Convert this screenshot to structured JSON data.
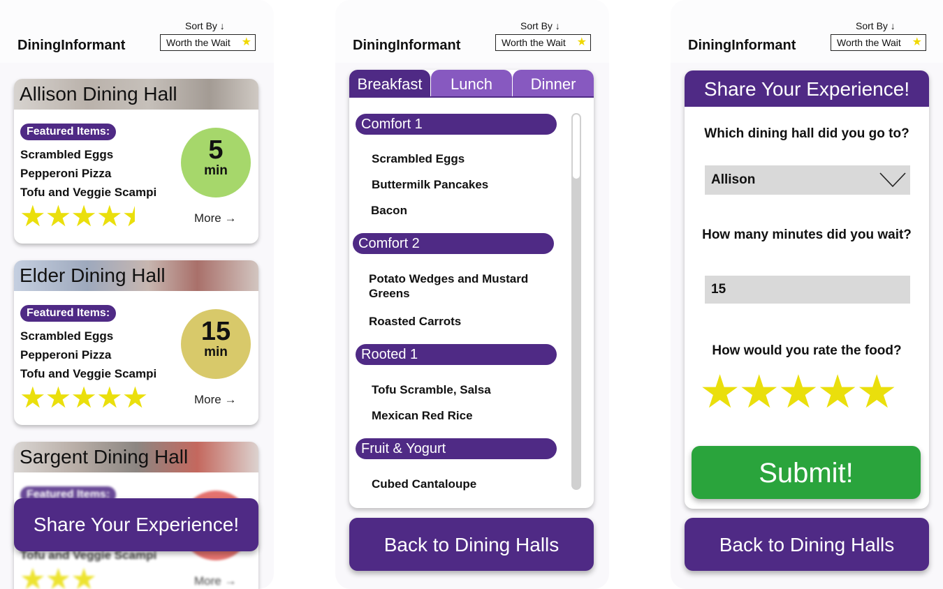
{
  "app": {
    "brand": "DiningInformant",
    "sort_label": "Sort By ↓",
    "sort_value": "Worth the Wait",
    "sort_star": "★",
    "accent_color": "#4f2a85",
    "tab_inactive_color": "#8759c0",
    "star_color": "#eadf0c",
    "submit_color": "#2aa43c"
  },
  "halls": {
    "featured_label": "Featured Items:",
    "more_label": "More →",
    "share_button": "Share Your Experience!",
    "items": [
      {
        "name": "Allison Dining Hall",
        "featured": [
          "Scrambled Eggs",
          "Pepperoni Pizza",
          "Tofu and Veggie Scampi"
        ],
        "wait_value": "5",
        "wait_unit": "min",
        "wait_color": "#a6d76b",
        "rating": 4.5,
        "stars_text": "★★★★",
        "half_star": "★"
      },
      {
        "name": "Elder Dining Hall",
        "featured": [
          "Scrambled Eggs",
          "Pepperoni Pizza",
          "Tofu and Veggie Scampi"
        ],
        "wait_value": "15",
        "wait_unit": "min",
        "wait_color": "#d8c96a",
        "rating": 5,
        "stars_text": "★★★★★"
      },
      {
        "name": "Sargent Dining Hall",
        "featured": [
          "Tofu and Veggie Scampi"
        ],
        "wait_color": "#e05a55",
        "rating": 3,
        "stars_text": "★★★"
      }
    ]
  },
  "menu": {
    "tabs": [
      "Breakfast",
      "Lunch",
      "Dinner"
    ],
    "active_tab": "Breakfast",
    "stations": [
      {
        "name": "Comfort 1",
        "items": [
          "Scrambled Eggs",
          "Buttermilk Pancakes",
          "Bacon"
        ]
      },
      {
        "name": "Comfort 2",
        "items": [
          "Potato Wedges and Mustard Greens",
          "Roasted Carrots"
        ]
      },
      {
        "name": "Rooted 1",
        "items": [
          "Tofu Scramble, Salsa",
          "Mexican Red Rice"
        ]
      },
      {
        "name": "Fruit & Yogurt",
        "items": [
          "Cubed Cantaloupe"
        ]
      }
    ],
    "back_button": "Back to Dining Halls"
  },
  "form": {
    "title": "Share Your Experience!",
    "q1": "Which dining hall did you go to?",
    "hall_value": "Allison",
    "q2": "How many minutes did you wait?",
    "minutes_value": "15",
    "q3": "How would you rate the food?",
    "rating": 5,
    "stars_text": "★★★★★",
    "submit": "Submit!",
    "back_button": "Back to Dining Halls"
  }
}
